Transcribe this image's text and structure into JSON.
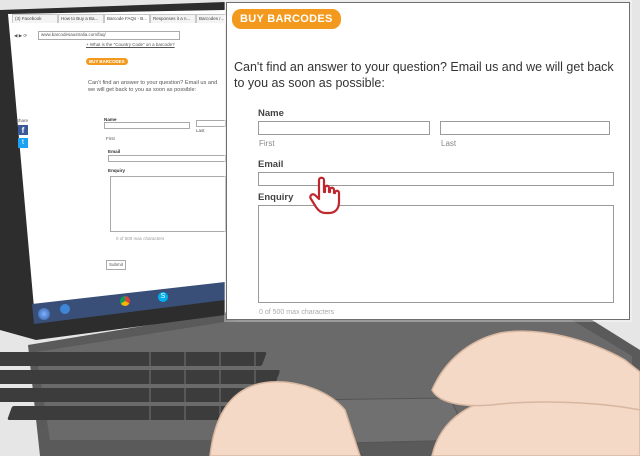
{
  "browser": {
    "tabs": [
      "(3) Facebook",
      "How to Buy a Ba...",
      "Barcode FAQs - B...",
      "Responses it a n...",
      "Barcodes r..."
    ],
    "url": "www.barcodesaustralia.com/faq/"
  },
  "page": {
    "breadcrumb_link": "+ What is the \"Country Code\" on a barcode?",
    "buy_label": "BUY BARCODES",
    "question": "Can't find an answer to your question? Email us and we will get back to you as soon as possible:",
    "share_label": "Share",
    "form": {
      "name_label": "Name",
      "first_label": "First",
      "last_label": "Last",
      "email_label": "Email",
      "enquiry_label": "Enquiry",
      "counter": "0 of 500 max characters",
      "submit_label": "Submit"
    }
  },
  "colors": {
    "accent": "#f39a1e",
    "facebook": "#3b5998",
    "twitter": "#1da1f2"
  },
  "icons": [
    "facebook-icon",
    "twitter-icon",
    "hand-pointer-icon",
    "windows-start-icon",
    "ie-icon",
    "chrome-icon",
    "skype-icon"
  ]
}
